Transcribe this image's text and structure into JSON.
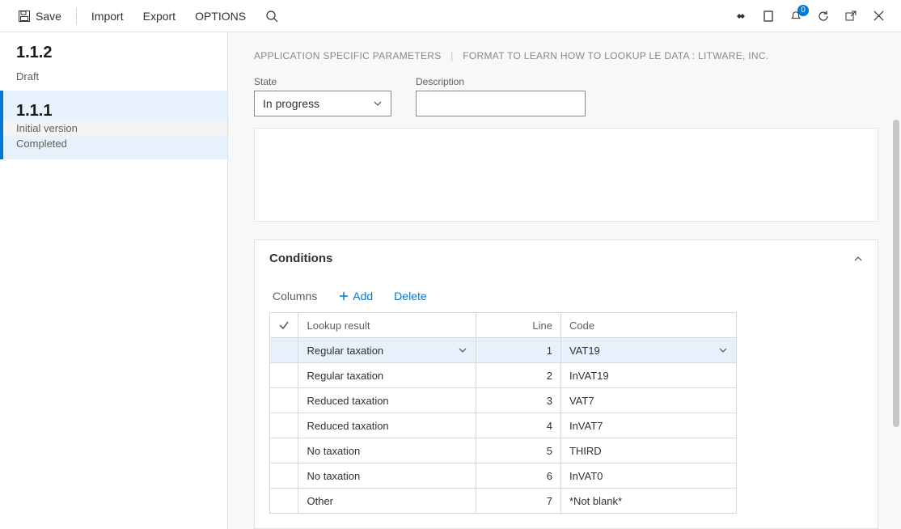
{
  "toolbar": {
    "save": "Save",
    "import": "Import",
    "export": "Export",
    "options": "OPTIONS",
    "badge_count": "0"
  },
  "sidebar": {
    "versions": [
      {
        "number": "1.1.2",
        "status": "Draft",
        "selected": false
      },
      {
        "number": "1.1.1",
        "status": "",
        "selected": true,
        "lines": [
          "Initial version",
          "Completed"
        ]
      }
    ]
  },
  "breadcrumb": {
    "part1": "APPLICATION SPECIFIC PARAMETERS",
    "part2": "FORMAT TO LEARN HOW TO LOOKUP LE DATA : LITWARE, INC."
  },
  "form": {
    "state_label": "State",
    "state_value": "In progress",
    "desc_label": "Description",
    "desc_value": ""
  },
  "conditions": {
    "title": "Conditions",
    "columns_label": "Columns",
    "add_label": "Add",
    "delete_label": "Delete",
    "headers": {
      "lookup": "Lookup result",
      "line": "Line",
      "code": "Code"
    },
    "rows": [
      {
        "lookup": "Regular taxation",
        "line": "1",
        "code": "VAT19",
        "selected": true
      },
      {
        "lookup": "Regular taxation",
        "line": "2",
        "code": "InVAT19"
      },
      {
        "lookup": "Reduced taxation",
        "line": "3",
        "code": "VAT7"
      },
      {
        "lookup": "Reduced taxation",
        "line": "4",
        "code": "InVAT7"
      },
      {
        "lookup": "No taxation",
        "line": "5",
        "code": "THIRD"
      },
      {
        "lookup": "No taxation",
        "line": "6",
        "code": "InVAT0"
      },
      {
        "lookup": "Other",
        "line": "7",
        "code": "*Not blank*"
      }
    ]
  }
}
